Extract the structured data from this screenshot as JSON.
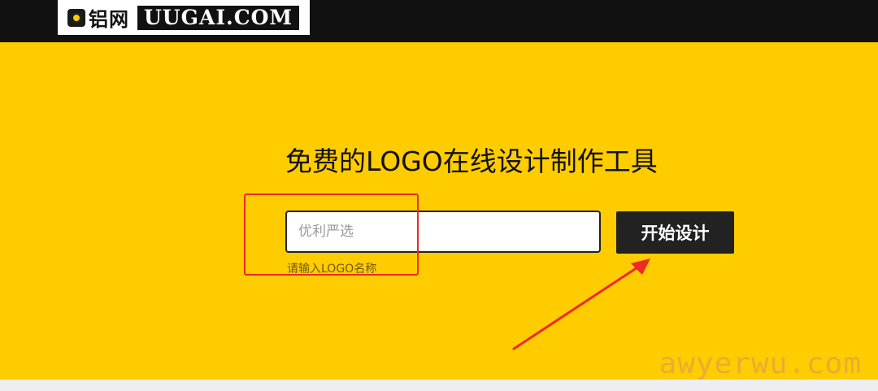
{
  "header": {
    "logo_cn": "铝网",
    "logo_en": "UUGAI.COM"
  },
  "hero": {
    "title": "免费的LOGO在线设计制作工具"
  },
  "form": {
    "name_input": {
      "value": "",
      "placeholder": "优利严选"
    },
    "hint": "请输入LOGO名称",
    "start_button": "开始设计"
  },
  "watermark": "awyerwu.com",
  "colors": {
    "background": "#ffcc00",
    "topbar": "#111111",
    "button": "#222222",
    "annotation": "#ee2a24"
  },
  "icons": {
    "logo": "gear-icon",
    "annotation_arrow": "arrow-icon"
  }
}
